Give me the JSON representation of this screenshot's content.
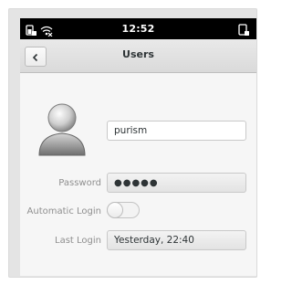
{
  "statusbar": {
    "time": "12:52",
    "icons": [
      "battery-lock-icon",
      "wifi-off-icon",
      "rotation-lock-icon"
    ]
  },
  "header": {
    "title": "Users",
    "back_icon": "chevron-left-icon"
  },
  "user": {
    "avatar_icon": "user-avatar-icon",
    "username": "purism"
  },
  "form": {
    "password_label": "Password",
    "password_value": "●●●●●",
    "autologin_label": "Automatic Login",
    "autologin_enabled": false,
    "lastlogin_label": "Last Login",
    "lastlogin_value": "Yesterday, 22:40"
  },
  "colors": {
    "statusbar_bg": "#000000",
    "header_bg": "#dedede",
    "content_bg": "#f6f6f6",
    "label_color": "#8f8f8f"
  }
}
